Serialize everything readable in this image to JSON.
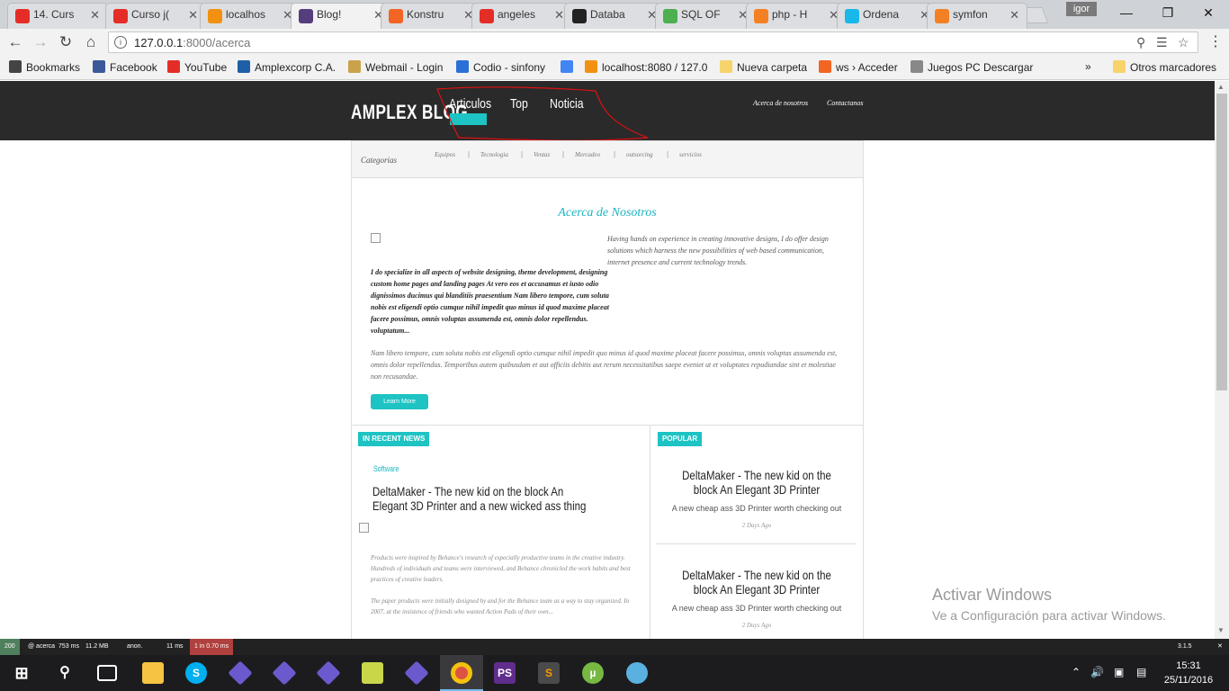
{
  "browser": {
    "tabs": [
      {
        "title": "14. Curs",
        "icon": "youtube-icon",
        "color": "#e52d27"
      },
      {
        "title": "Curso j(",
        "icon": "youtube-icon",
        "color": "#e52d27"
      },
      {
        "title": "localhos",
        "icon": "pma-icon",
        "color": "#f29111"
      },
      {
        "title": "Blog!",
        "icon": "bootstrap-icon",
        "color": "#563d7c"
      },
      {
        "title": "Konstru",
        "icon": "konstru-icon",
        "color": "#f26522"
      },
      {
        "title": "angeles",
        "icon": "youtube-icon",
        "color": "#e52d27"
      },
      {
        "title": "Databa",
        "icon": "symfony-icon",
        "color": "#222222"
      },
      {
        "title": "SQL OF",
        "icon": "w3-icon",
        "color": "#4caf50"
      },
      {
        "title": "php - H",
        "icon": "stackoverflow-icon",
        "color": "#f48024"
      },
      {
        "title": "Ordena",
        "icon": "vimeo-icon",
        "color": "#1ab7ea"
      },
      {
        "title": "symfon",
        "icon": "stackoverflow-icon",
        "color": "#f48024"
      }
    ],
    "active_tab_index": 3,
    "user_name": "igor",
    "url_host": "127.0.0.1",
    "url_path": ":8000/acerca",
    "bookmarks": [
      {
        "label": "Bookmarks",
        "icon": "star-icon"
      },
      {
        "label": "Facebook",
        "icon": "facebook-icon"
      },
      {
        "label": "YouTube",
        "icon": "youtube-icon"
      },
      {
        "label": "Amplexcorp C.A.",
        "icon": "amplex-icon"
      },
      {
        "label": "Webmail - Login",
        "icon": "mail-icon"
      },
      {
        "label": "Codio - sinfony",
        "icon": "codio-icon"
      },
      {
        "label": "",
        "icon": "google-icon"
      },
      {
        "label": "localhost:8080 / 127.0",
        "icon": "pma-icon"
      },
      {
        "label": "Nueva carpeta",
        "icon": "folder-icon"
      },
      {
        "label": "ws › Acceder",
        "icon": "ws-icon"
      },
      {
        "label": "Juegos PC Descargar",
        "icon": "page-icon"
      }
    ],
    "bookmarks_overflow": "»",
    "other_bookmarks": "Otros marcadores"
  },
  "site": {
    "logo": "AMPLEX BLOG",
    "main_nav": [
      "Articulos",
      "Top",
      "Noticia"
    ],
    "top_nav": [
      "Acerca de nosotros",
      "Contactanos"
    ],
    "categories_label": "Categorias",
    "categories": [
      "Equipos",
      "Tecnologia",
      "Ventas",
      "Mercadeo",
      "outsorcing",
      "servicios"
    ],
    "about": {
      "title": "Acerca de Nosotros",
      "right_text": "Having hands on experience in creating innovative designs, I do offer design solutions which harness the new possibilities of web based communication, internet presence and current technology trends.",
      "bold_text": "I do specialize in all aspects of website designing, theme development, designing custom home pages and landing pages At vero eos et accusamus et iusto odio dignissimos ducimus qui blanditiis praesentium Nam libero tempore, cum soluta nobis est eligendi optio cumque nihil impedit quo minus id quod maxime placeat facere possimus, omnis voluptas assumenda est, omnis dolor repellendus. voluptatum...",
      "paragraph": "Nam libero tempore, cum soluta nobis est eligendi optio cumque nihil impedit quo minus id quod maxime placeat facere possimus, omnis voluptas assumenda est, omnis dolor repellendus. Temporibus autem quibusdam et aut officiis debitis aut rerum necessitatibus saepe eveniet ut et voluptates repudiandae sint et molestiae non recusandae.",
      "button": "Learn More"
    },
    "recent_news": {
      "badge": "IN RECENT NEWS",
      "category": "Software",
      "title": "DeltaMaker - The new kid on the block An Elegant 3D Printer and a new wicked ass thing",
      "text1": "Products were inspired by Behance's research of especially productive teams in the creative industry. Hundreds of individuals and teams were interviewed, and Behance chronicled the work habits and best practices of creative leaders.",
      "text2": "The paper products were initially designed by and for the Behance team as a way to stay organized. In 2007, at the insistence of friends who wanted Action Pads of their own..."
    },
    "popular": {
      "badge": "POPULAR",
      "items": [
        {
          "title": "DeltaMaker - The new kid on the block An Elegant 3D Printer",
          "subtitle": "A new cheap ass 3D Printer worth checking out",
          "time": "2 Days Ago"
        },
        {
          "title": "DeltaMaker - The new kid on the block An Elegant 3D Printer",
          "subtitle": "A new cheap ass 3D Printer worth checking out",
          "time": "2 Days Ago"
        }
      ]
    }
  },
  "windows_activation": {
    "line1": "Activar Windows",
    "line2": "Ve a Configuración para activar Windows."
  },
  "symfony_toolbar": {
    "status": "200",
    "route": "@ acerca",
    "time": "753 ms",
    "memory": "11.2 MB",
    "user": "anon.",
    "twig": "11 ms",
    "queries": "1 in 0.70 ms",
    "version": "3.1.5"
  },
  "taskbar": {
    "time": "15:31",
    "date": "25/11/2016"
  }
}
